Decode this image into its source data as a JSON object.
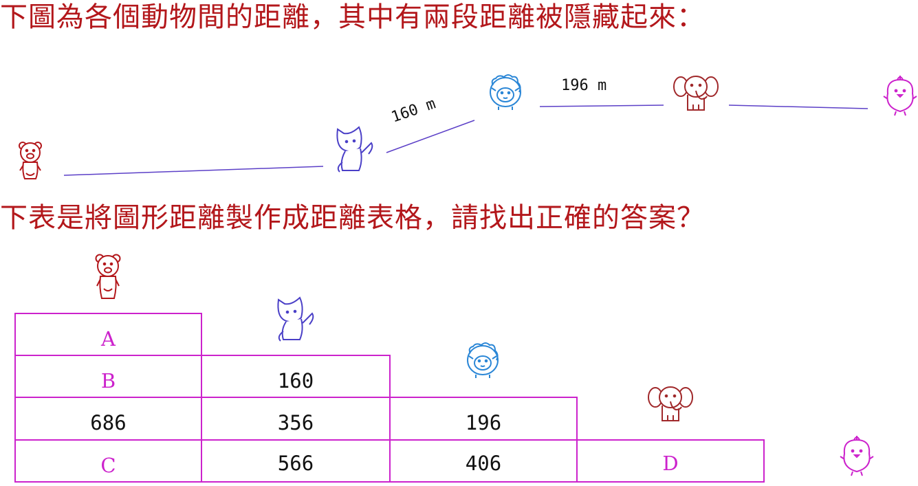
{
  "headings": {
    "top": "下圖為各個動物間的距離，其中有兩段距離被隱藏起來：",
    "middle": "下表是將圖形距離製作成距離表格，請找出正確的答案？"
  },
  "diagram": {
    "animals": [
      "bear",
      "fox",
      "sheep",
      "elephant",
      "chick"
    ],
    "segments": [
      {
        "from": "bear",
        "to": "fox",
        "label": ""
      },
      {
        "from": "fox",
        "to": "sheep",
        "label": "160 m"
      },
      {
        "from": "sheep",
        "to": "elephant",
        "label": "196 m"
      },
      {
        "from": "elephant",
        "to": "chick",
        "label": ""
      }
    ],
    "line_color": "#5b3fc7"
  },
  "table": {
    "border_color": "#cc22cc",
    "rows": [
      [
        "A"
      ],
      [
        "B",
        "160"
      ],
      [
        "686",
        "356",
        "196"
      ],
      [
        "C",
        "566",
        "406",
        "D"
      ]
    ]
  },
  "colors": {
    "heading": "#b3171b",
    "bear": "#b3171b",
    "fox": "#4a3fc7",
    "sheep": "#2a86d6",
    "elephant": "#a0282a",
    "chick": "#cc22cc"
  }
}
